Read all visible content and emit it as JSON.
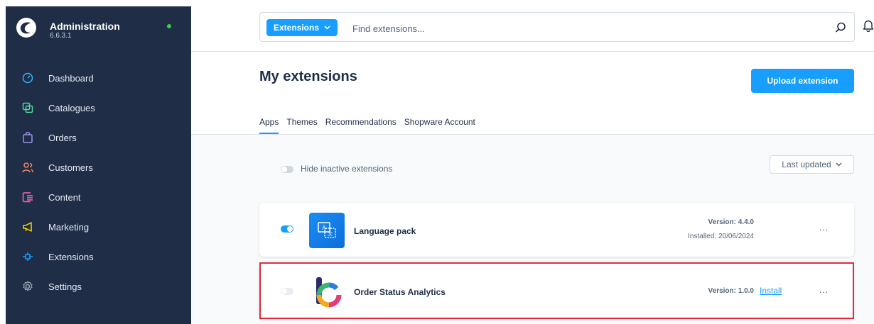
{
  "app": {
    "title": "Administration",
    "version": "6.6.3.1"
  },
  "sidebar": {
    "items": [
      {
        "label": "Dashboard",
        "icon": "dashboard-icon",
        "color": "#2bb6ff"
      },
      {
        "label": "Catalogues",
        "icon": "products-icon",
        "color": "#57d9a3"
      },
      {
        "label": "Orders",
        "icon": "shopping-bag-icon",
        "color": "#a092f0"
      },
      {
        "label": "Customers",
        "icon": "customers-icon",
        "color": "#f88962"
      },
      {
        "label": "Content",
        "icon": "content-icon",
        "color": "#ff68b4"
      },
      {
        "label": "Marketing",
        "icon": "marketing-icon",
        "color": "#ffd700"
      },
      {
        "label": "Extensions",
        "icon": "extensions-icon",
        "color": "#189eff"
      },
      {
        "label": "Settings",
        "icon": "settings-icon",
        "color": "#9aa8b5"
      }
    ]
  },
  "search": {
    "type_label": "Extensions",
    "placeholder": "Find extensions..."
  },
  "page": {
    "title": "My extensions",
    "upload_label": "Upload extension"
  },
  "tabs": [
    {
      "label": "Apps",
      "active": true
    },
    {
      "label": "Themes",
      "active": false
    },
    {
      "label": "Recommendations",
      "active": false
    },
    {
      "label": "Shopware Account",
      "active": false
    }
  ],
  "filters": {
    "hide_inactive_label": "Hide inactive extensions",
    "hide_inactive_on": false,
    "sort_label": "Last updated"
  },
  "extensions": [
    {
      "name": "Language pack",
      "version": "Version: 4.4.0",
      "installed": "Installed: 20/06/2024",
      "active": true,
      "more": "···"
    },
    {
      "name": "Order Status Analytics",
      "version": "Version: 1.0.0",
      "install_label": "Install",
      "active": false,
      "more": "···"
    }
  ],
  "colors": {
    "accent": "#189eff",
    "sidebar_bg": "#1f2d46",
    "highlight": "#e02b3a",
    "status_online": "#37d046"
  }
}
